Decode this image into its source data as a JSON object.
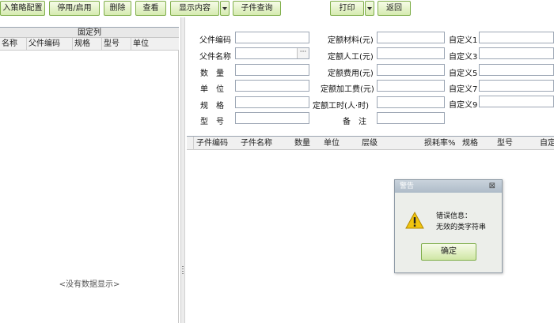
{
  "toolbar": {
    "strategy_config": "入策略配置",
    "toggle_enable": "停用/启用",
    "delete": "删除",
    "view": "查看",
    "show_content": "显示内容",
    "child_query": "子件查询",
    "print": "打印",
    "back": "返回"
  },
  "left_panel": {
    "fixed_columns_title": "固定列",
    "columns": [
      "名称",
      "父件编码",
      "规格",
      "型号",
      "单位"
    ],
    "empty_message": "<没有数据显示>"
  },
  "form": {
    "parent_code": {
      "label": "父件编码",
      "value": ""
    },
    "parent_name": {
      "label": "父件名称",
      "value": "",
      "lookup": "···"
    },
    "quantity": {
      "label": "数　量",
      "value": ""
    },
    "unit": {
      "label": "单　位",
      "value": ""
    },
    "spec": {
      "label": "规　格",
      "value": ""
    },
    "model": {
      "label": "型　号",
      "value": ""
    },
    "quota_material": {
      "label": "定额材料(元)",
      "value": ""
    },
    "quota_labor": {
      "label": "定额人工(元)",
      "value": ""
    },
    "quota_expense": {
      "label": "定额费用(元)",
      "value": ""
    },
    "quota_processing": {
      "label": "定额加工费(元)",
      "value": ""
    },
    "quota_hours": {
      "label": "定额工时(人·时)",
      "value": ""
    },
    "remark": {
      "label": "备　注",
      "value": ""
    },
    "custom1": {
      "label": "自定义1",
      "value": ""
    },
    "custom3": {
      "label": "自定义3",
      "value": ""
    },
    "custom5": {
      "label": "自定义5",
      "value": ""
    },
    "custom7": {
      "label": "自定义7",
      "value": ""
    },
    "custom9": {
      "label": "自定义9",
      "value": ""
    }
  },
  "grid": {
    "columns": [
      "子件编码",
      "子件名称",
      "数量",
      "单位",
      "层级",
      "损耗率%",
      "规格",
      "型号",
      "自定"
    ]
  },
  "dialog": {
    "title": "警告",
    "close_glyph": "⊠",
    "error_heading": "错误信息：",
    "error_message": "无效的类字符串",
    "ok": "确定"
  },
  "colors": {
    "button_border": "#7fae4a",
    "button_fill": "#d6ebb0",
    "dialog_title": "#aebbc8",
    "warning_yellow": "#f1c40f"
  }
}
